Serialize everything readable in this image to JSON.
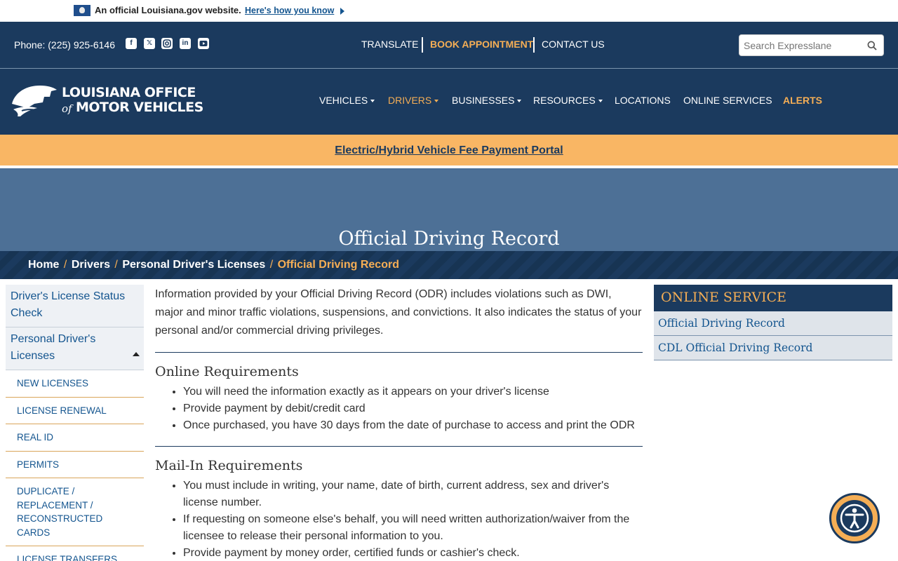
{
  "gov_banner": {
    "text": "An official Louisiana.gov website.",
    "link": "Here's how you know"
  },
  "utility": {
    "phone": "Phone: (225) 925-6146",
    "social": [
      "facebook-icon",
      "x-icon",
      "instagram-icon",
      "linkedin-icon",
      "youtube-icon"
    ],
    "links": {
      "translate": "TRANSLATE",
      "book": "BOOK APPOINTMENT",
      "contact": "CONTACT US"
    },
    "search_placeholder": "Search Expresslane"
  },
  "logo": {
    "line1": "LOUISIANA OFFICE",
    "of": "of",
    "line2": "MOTOR VEHICLES"
  },
  "nav": {
    "vehicles": "VEHICLES",
    "drivers": "DRIVERS",
    "businesses": "BUSINESSES",
    "resources": "RESOURCES",
    "locations": "LOCATIONS",
    "online": "ONLINE SERVICES",
    "alerts": "ALERTS"
  },
  "alert_strip": "Electric/Hybrid Vehicle Fee Payment Portal",
  "hero_title": "Official Driving Record",
  "breadcrumb": {
    "home": "Home",
    "drivers": "Drivers",
    "licenses": "Personal Driver's Licenses",
    "current": "Official Driving Record",
    "sep": "/"
  },
  "sidebar": {
    "top": [
      "Driver's License Status Check",
      "Personal Driver's Licenses"
    ],
    "sub": [
      "NEW LICENSES",
      "LICENSE RENEWAL",
      "REAL ID",
      "PERMITS",
      "DUPLICATE / REPLACEMENT / RECONSTRUCTED CARDS",
      "LICENSE TRANSFERS"
    ]
  },
  "content": {
    "intro": "Information provided by your Official Driving Record (ODR) includes violations such as DWI, major and minor traffic violations, suspensions, and convictions.  It also indicates the status of your personal and/or commercial driving privileges.",
    "online_heading": "Online Requirements",
    "online_items": [
      "You will need the information exactly as it appears on your driver's license",
      "Provide payment by debit/credit card",
      "Once purchased, you have 30 days from the date of purchase to access and print the ODR"
    ],
    "mail_heading": "Mail-In Requirements",
    "mail_items": [
      "You must include in writing, your name, date of birth, current address, sex and driver's license number.",
      "If requesting on someone else's behalf, you will need written authorization/waiver from the licensee to release their personal information to you.",
      "Provide payment by money order, certified funds or cashier's check."
    ]
  },
  "panel": {
    "heading": "ONLINE SERVICE",
    "links": [
      "Official Driving Record",
      "CDL Official Driving Record"
    ]
  },
  "colors": {
    "navy": "#1b3a5e",
    "orange": "#f5ae55",
    "hero": "#4d7096",
    "link": "#14558f"
  }
}
